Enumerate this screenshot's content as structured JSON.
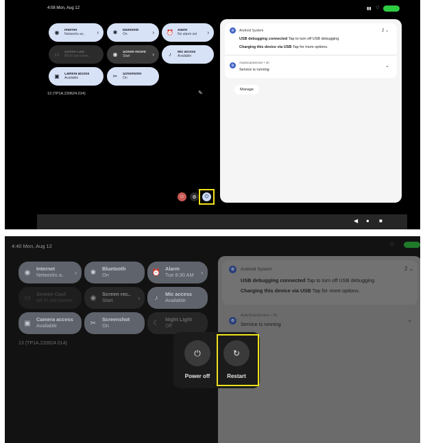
{
  "shot1": {
    "status": {
      "time_date": "4:08  Mon, Aug 12"
    },
    "tiles": [
      {
        "title": "Internet",
        "subtitle": "Networks av..",
        "icon": "wifi-icon",
        "glyph": "◉",
        "chevron": "›"
      },
      {
        "title": "Bluetooth",
        "subtitle": "On",
        "icon": "bluetooth-icon",
        "glyph": "✱",
        "chevron": "›"
      },
      {
        "title": "Alarm",
        "subtitle": "No alarm set",
        "icon": "alarm-icon",
        "glyph": "⏰",
        "chevron": "›"
      },
      {
        "title": "Screen Cast",
        "subtitle": "Wi-Fi not conne..",
        "icon": "cast-icon",
        "glyph": "▭"
      },
      {
        "title": "Screen record",
        "subtitle": "Start",
        "icon": "record-icon",
        "glyph": "◉",
        "chevron": "›"
      },
      {
        "title": "Mic access",
        "subtitle": "Available",
        "icon": "mic-icon",
        "glyph": "♪"
      },
      {
        "title": "Camera access",
        "subtitle": "Available",
        "icon": "camera-icon",
        "glyph": "▣"
      },
      {
        "title": "Screenshot",
        "subtitle": "On",
        "icon": "scissors-icon",
        "glyph": "✂"
      }
    ],
    "build": "13 (TP1A.220624.014)",
    "notifications": {
      "n1_app": "Android System",
      "n1_badge": "2",
      "n1_line1_bold": "USB debugging connected",
      "n1_line1_rest": " Tap to turn off USB debugging",
      "n1_line2_bold": "Charging this device via USB",
      "n1_line2_rest": " Tap for more options.",
      "n2_app": "AutoScanService • 1h",
      "n2_text": "Service is running",
      "manage": "Manage"
    },
    "nav": {
      "back": "◀",
      "home": "●",
      "recents": "■"
    }
  },
  "shot2": {
    "status": {
      "time_date": "4:40  Mon, Aug 12"
    },
    "tiles": [
      {
        "title": "Internet",
        "subtitle": "Networks a..",
        "icon": "wifi-icon",
        "glyph": "◉",
        "chevron": "›"
      },
      {
        "title": "Bluetooth",
        "subtitle": "On",
        "icon": "bluetooth-icon",
        "glyph": "✱"
      },
      {
        "title": "Alarm",
        "subtitle": "Tue 8:30 AM",
        "icon": "alarm-icon",
        "glyph": "⏰",
        "chevron": "›"
      },
      {
        "title": "Screen Cast",
        "subtitle": "Wi-Fi not conne..",
        "icon": "cast-icon",
        "glyph": "▭"
      },
      {
        "title": "Screen rec..",
        "subtitle": "Start",
        "icon": "record-icon",
        "glyph": "◉",
        "chevron": "›"
      },
      {
        "title": "Mic access",
        "subtitle": "Available",
        "icon": "mic-icon",
        "glyph": "♪"
      },
      {
        "title": "Camera access",
        "subtitle": "Available",
        "icon": "camera-icon",
        "glyph": "▣"
      },
      {
        "title": "Screenshot",
        "subtitle": "On",
        "icon": "scissors-icon",
        "glyph": "✂"
      },
      {
        "title": "Night Light",
        "subtitle": "Off",
        "icon": "moon-icon",
        "glyph": "☾"
      }
    ],
    "build": "13 (TP1A.220624.014)",
    "notifications": {
      "n1_app": "Android System",
      "n1_badge": "2",
      "n1_line1_bold": "USB debugging connected",
      "n1_line1_rest": " Tap to turn off USB debugging",
      "n1_line2_bold": "Charging this device via USB",
      "n1_line2_rest": " Tap for more options.",
      "n2_app": "AutoScanService • 2h",
      "n2_text": "Service is running"
    },
    "power_menu": {
      "power_off": "Power off",
      "restart": "Restart",
      "power_glyph": "⏻",
      "restart_glyph": "↻"
    }
  },
  "colors": {
    "highlight": "#f2e31b",
    "tile_on": "#d8e2f7",
    "battery": "#2ecc40"
  },
  "glyphs": {
    "chevron_down": "⌄",
    "edit": "✎",
    "wifi_status": "♡"
  }
}
